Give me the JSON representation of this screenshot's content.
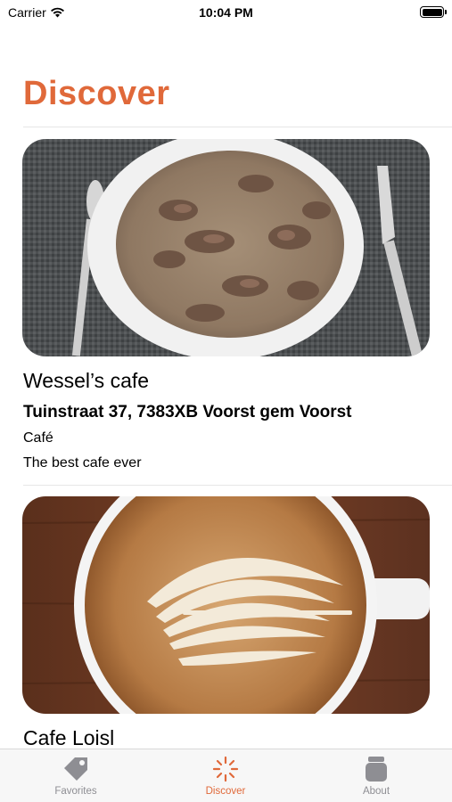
{
  "status_bar": {
    "carrier": "Carrier",
    "time": "10:04 PM"
  },
  "page": {
    "title": "Discover"
  },
  "cafes": [
    {
      "name": "Wessel’s cafe",
      "address": "Tuinstraat 37, 7383XB Voorst gem Voorst",
      "category": "Café",
      "description": "The best cafe ever",
      "image": "stew-bowl-photo"
    },
    {
      "name": "Cafe Loisl",
      "image": "latte-art-photo"
    }
  ],
  "tab_bar": {
    "tabs": [
      {
        "label": "Favorites",
        "icon": "tag-icon",
        "active": false
      },
      {
        "label": "Discover",
        "icon": "sparkle-icon",
        "active": true
      },
      {
        "label": "About",
        "icon": "jar-icon",
        "active": false
      }
    ]
  },
  "colors": {
    "accent": "#e0693a",
    "inactive": "#8e8e93"
  }
}
